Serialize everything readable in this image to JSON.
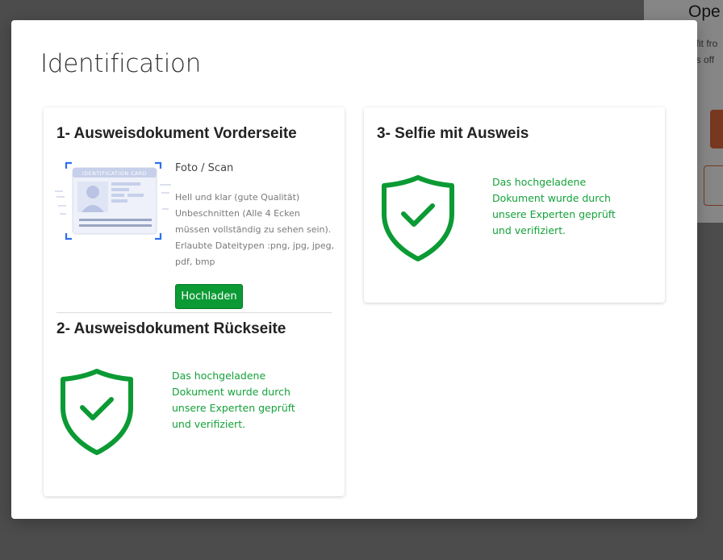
{
  "background": {
    "title": "Ope",
    "line1": "efit fro",
    "line2": "gs off"
  },
  "modal": {
    "title": "Identification"
  },
  "front": {
    "title": "1- Ausweisdokument Vorderseite",
    "idcard_label": "IDENTIFICATION CARD",
    "instruction_head": "Foto / Scan",
    "instruction_lines": "Hell und klar (gute Qualität) Unbeschnitten (Alle 4 Ecken müssen vollständig zu sehen sein). Erlaubte Dateitypen :png, jpg, jpeg, pdf, bmp",
    "upload_label": "Hochladen",
    "icon": "id-card-scan-icon"
  },
  "back": {
    "title": "2- Ausweisdokument Rückseite",
    "status": "Das hochgeladene Dokument wurde durch unsere Experten geprüft und verifiziert.",
    "icon": "shield-check-icon"
  },
  "selfie": {
    "title": "3- Selfie mit Ausweis",
    "status": "Das hochgeladene Dokument wurde durch unsere Experten geprüft und verifiziert.",
    "icon": "shield-check-icon"
  },
  "colors": {
    "accent_green": "#0b9a34",
    "verified_text": "#14a23a",
    "background_accent": "#d9663a"
  }
}
